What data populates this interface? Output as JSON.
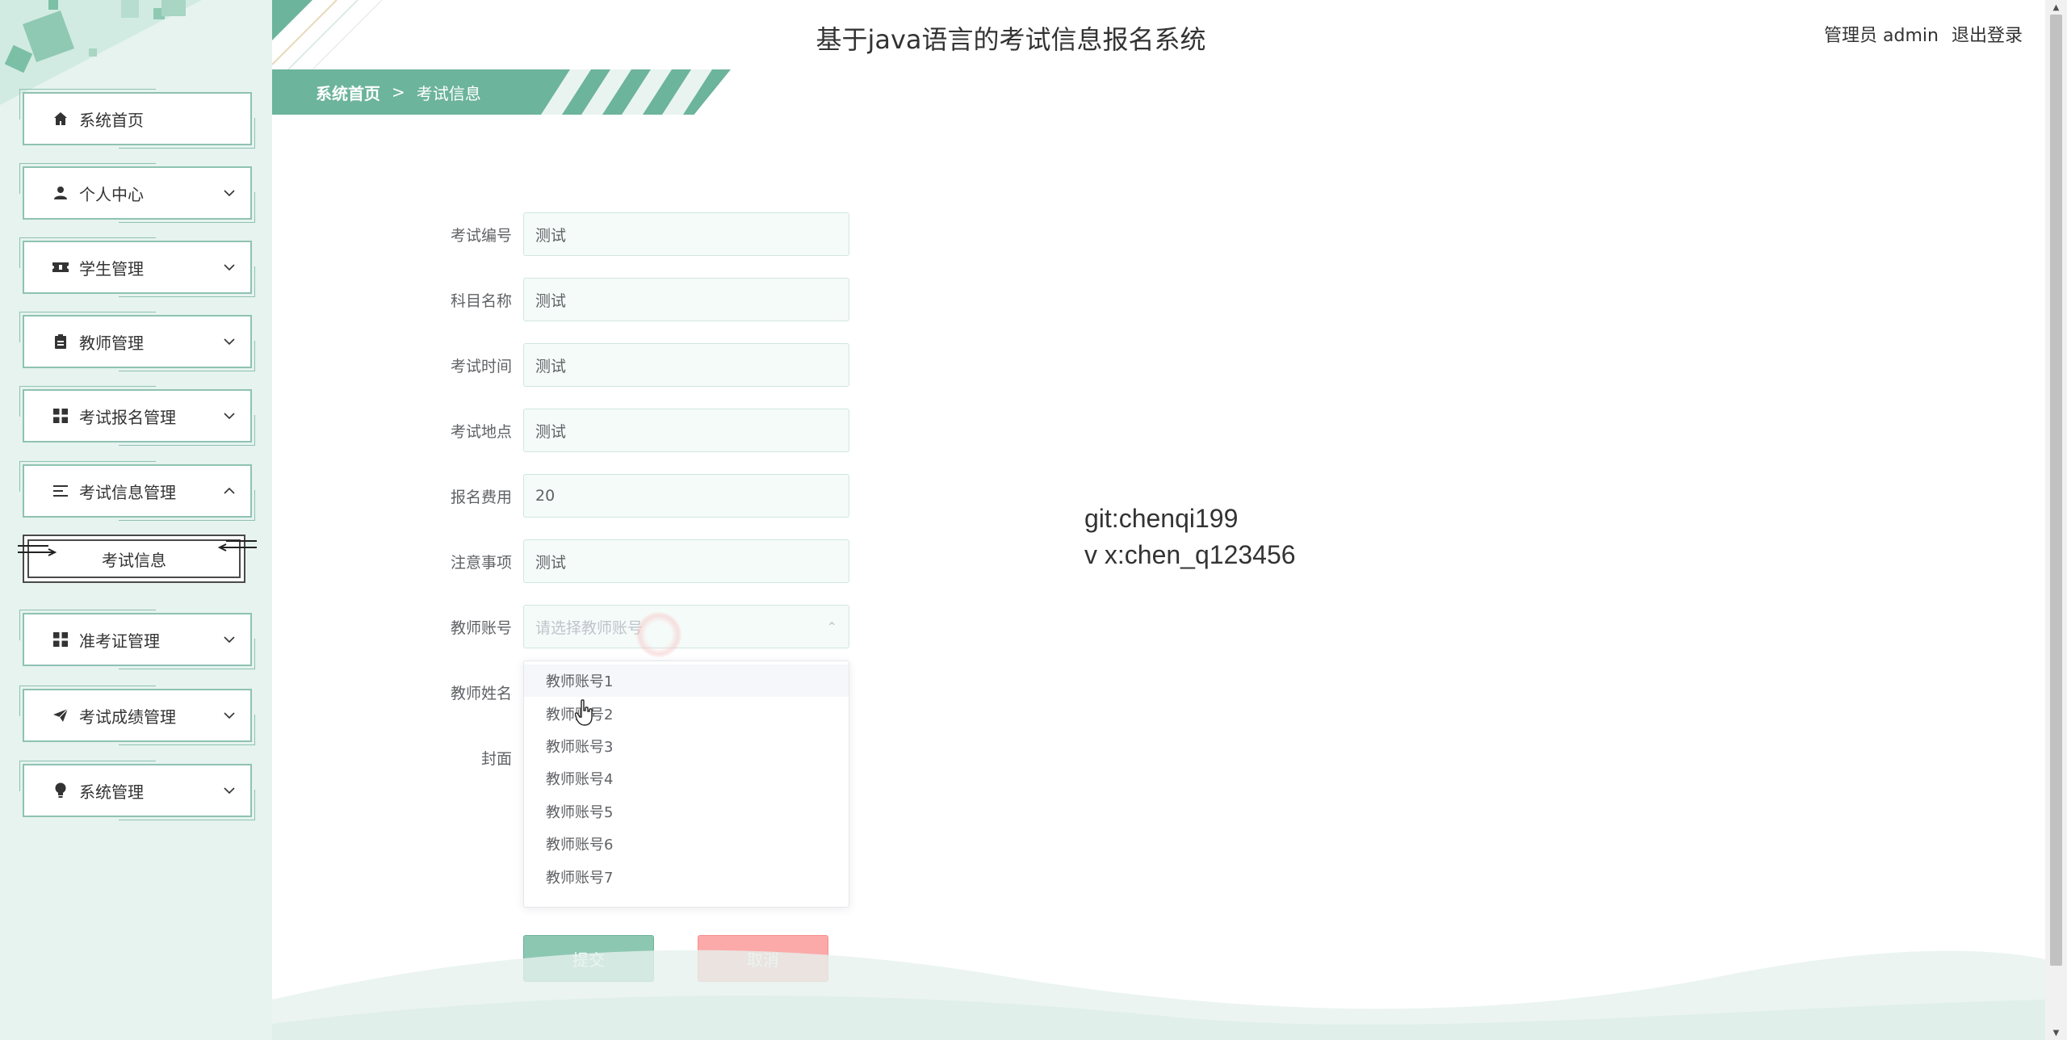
{
  "header": {
    "title": "基于java语言的考试信息报名系统",
    "user": "管理员 admin",
    "logout": "退出登录"
  },
  "breadcrumb": {
    "home": "系统首页",
    "separator": ">",
    "current": "考试信息"
  },
  "sidebar": {
    "items": [
      {
        "label": "系统首页",
        "icon": "home-icon"
      },
      {
        "label": "个人中心",
        "icon": "person-icon"
      },
      {
        "label": "学生管理",
        "icon": "ticket-icon"
      },
      {
        "label": "教师管理",
        "icon": "clipboard-icon"
      },
      {
        "label": "考试报名管理",
        "icon": "grid-icon"
      },
      {
        "label": "考试信息管理",
        "icon": "list-icon"
      },
      {
        "label": "准考证管理",
        "icon": "grid-icon"
      },
      {
        "label": "考试成绩管理",
        "icon": "send-icon"
      },
      {
        "label": "系统管理",
        "icon": "bulb-icon"
      }
    ],
    "submenu_active": "考试信息"
  },
  "form": {
    "fields": [
      {
        "label": "考试编号",
        "value": "测试"
      },
      {
        "label": "科目名称",
        "value": "测试"
      },
      {
        "label": "考试时间",
        "value": "测试"
      },
      {
        "label": "考试地点",
        "value": "测试"
      },
      {
        "label": "报名费用",
        "value": "20"
      },
      {
        "label": "注意事项",
        "value": "测试"
      }
    ],
    "teacher_account": {
      "label": "教师账号",
      "placeholder": "请选择教师账号"
    },
    "teacher_name": {
      "label": "教师姓名"
    },
    "cover": {
      "label": "封面"
    },
    "dropdown_options": [
      "教师账号1",
      "教师账号2",
      "教师账号3",
      "教师账号4",
      "教师账号5",
      "教师账号6",
      "教师账号7"
    ],
    "submit": "提交",
    "cancel": "取消"
  },
  "watermark": {
    "line1": "git:chenqi199",
    "line2": "v x:chen_q123456"
  },
  "colors": {
    "primary": "#6cb49b",
    "sidebar_bg": "#e6f3ef",
    "submit": "#8cc7b2",
    "cancel": "#fbaaa9"
  }
}
